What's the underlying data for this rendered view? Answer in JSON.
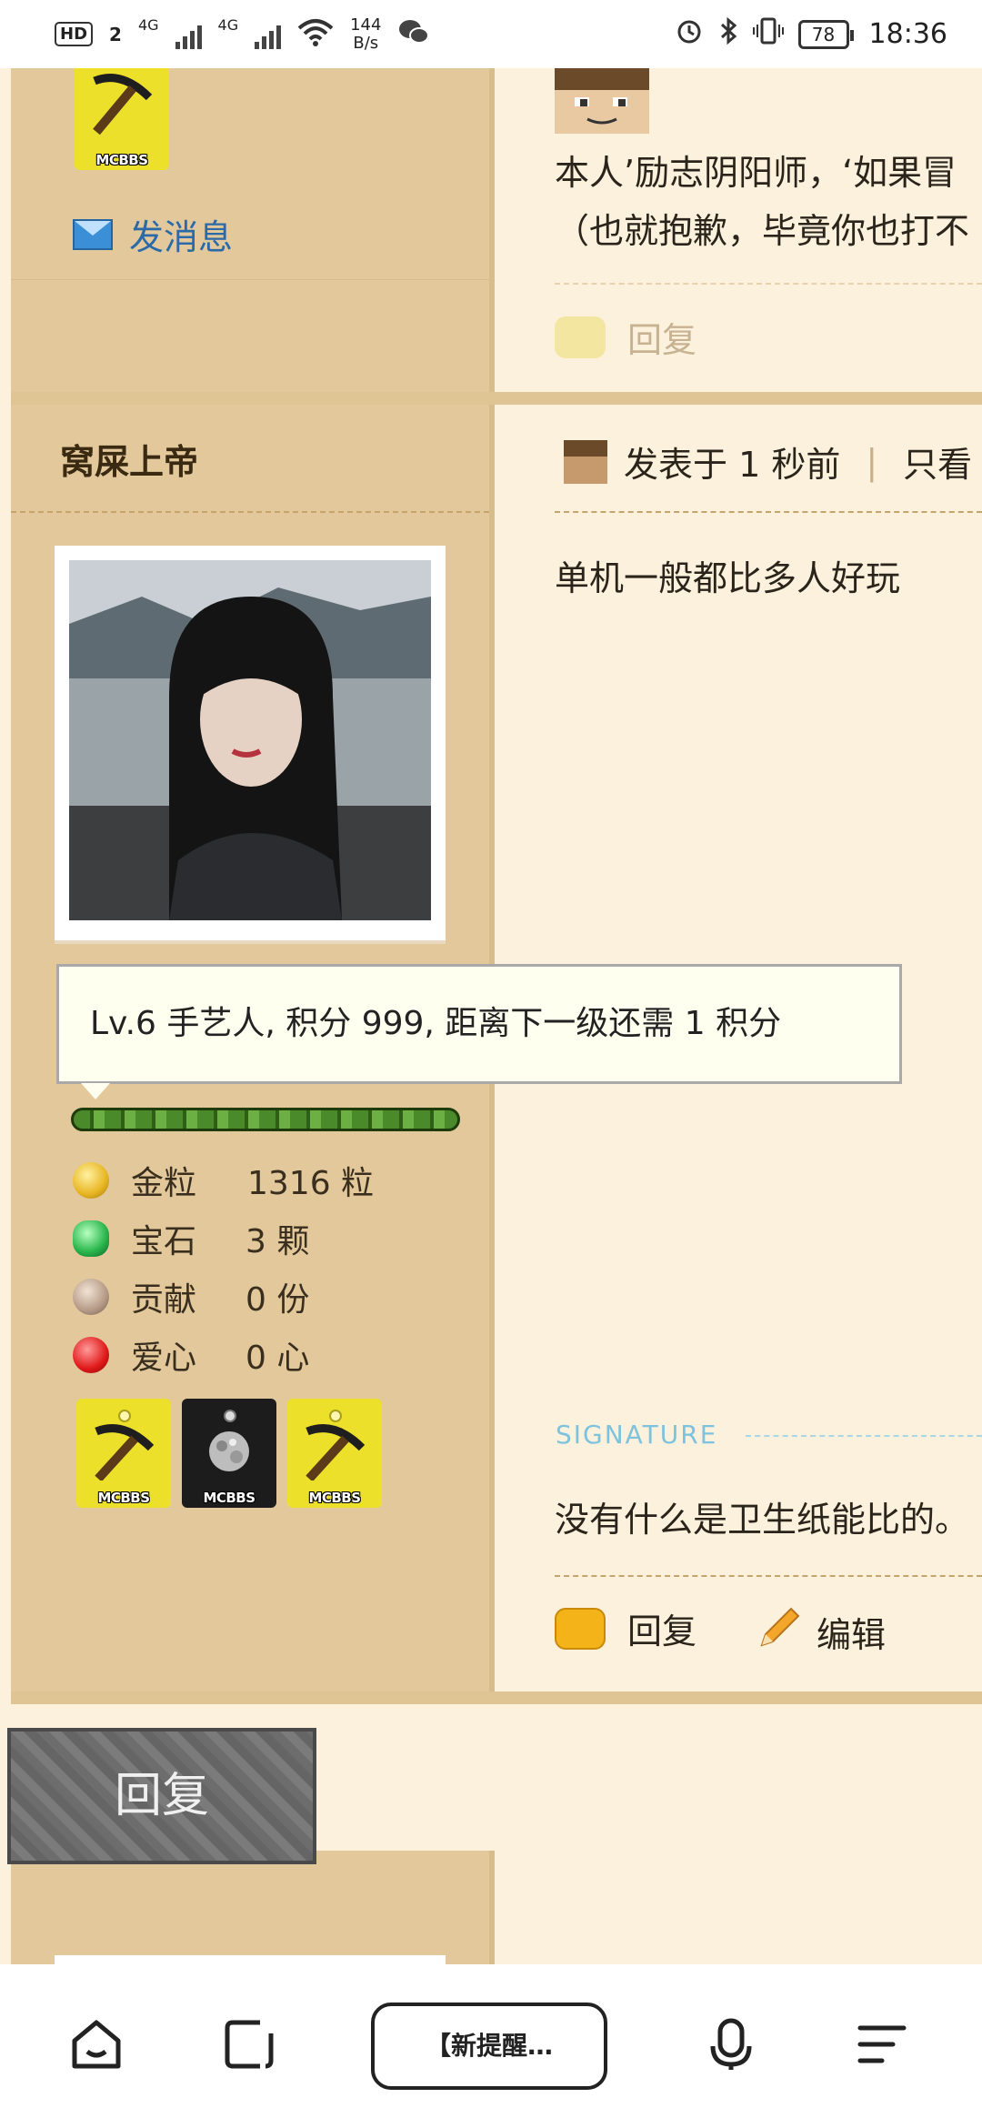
{
  "status_bar": {
    "hd": "HD",
    "sim1": "2",
    "net1": "4G",
    "net2": "4G",
    "speed_value": "144",
    "speed_unit": "B/s",
    "battery": "78",
    "time": "18:36"
  },
  "post1": {
    "message_link": "发消息",
    "body_line1": "本人’励志阴阳师，‘如果冒",
    "body_line2": "（也就抱歉，毕竟你也打不",
    "reply_label": "回复"
  },
  "post2": {
    "username": "窝屎上帝",
    "meta_posted": "发表于 1 秒前",
    "meta_separator": "|",
    "meta_only": "只看",
    "content": "单机一般都比多人好玩",
    "tooltip": "Lv.6 手艺人, 积分 999, 距离下一级还需 1 积分",
    "stats": [
      {
        "icon": "gold-nugget-icon",
        "label": "金粒",
        "value": "1316 粒"
      },
      {
        "icon": "emerald-icon",
        "label": "宝石",
        "value": "3 颗"
      },
      {
        "icon": "contribution-icon",
        "label": "贡献",
        "value": "0 份"
      },
      {
        "icon": "apple-heart-icon",
        "label": "爱心",
        "value": "0 心"
      }
    ],
    "medal_labels": [
      "MCBBS",
      "MCBBS",
      "MCBBS"
    ],
    "signature_title": "SIGNATURE",
    "signature_text": "没有什么是卫生纸能比的。",
    "reply_label": "回复",
    "edit_label": "编辑"
  },
  "big_reply_button": "回复",
  "top_medal_label": "MCBBS",
  "nav": {
    "tab_label": "【新提醒…",
    "home_icon": "home-icon",
    "tabs_icon": "tabs-icon",
    "voice_icon": "microphone-icon",
    "menu_icon": "menu-icon"
  },
  "colors": {
    "sidebar": "#e2c89a",
    "content_bg": "#fbf1dc",
    "link_blue": "#2b6aa8",
    "signature_blue": "#7ec3de"
  }
}
